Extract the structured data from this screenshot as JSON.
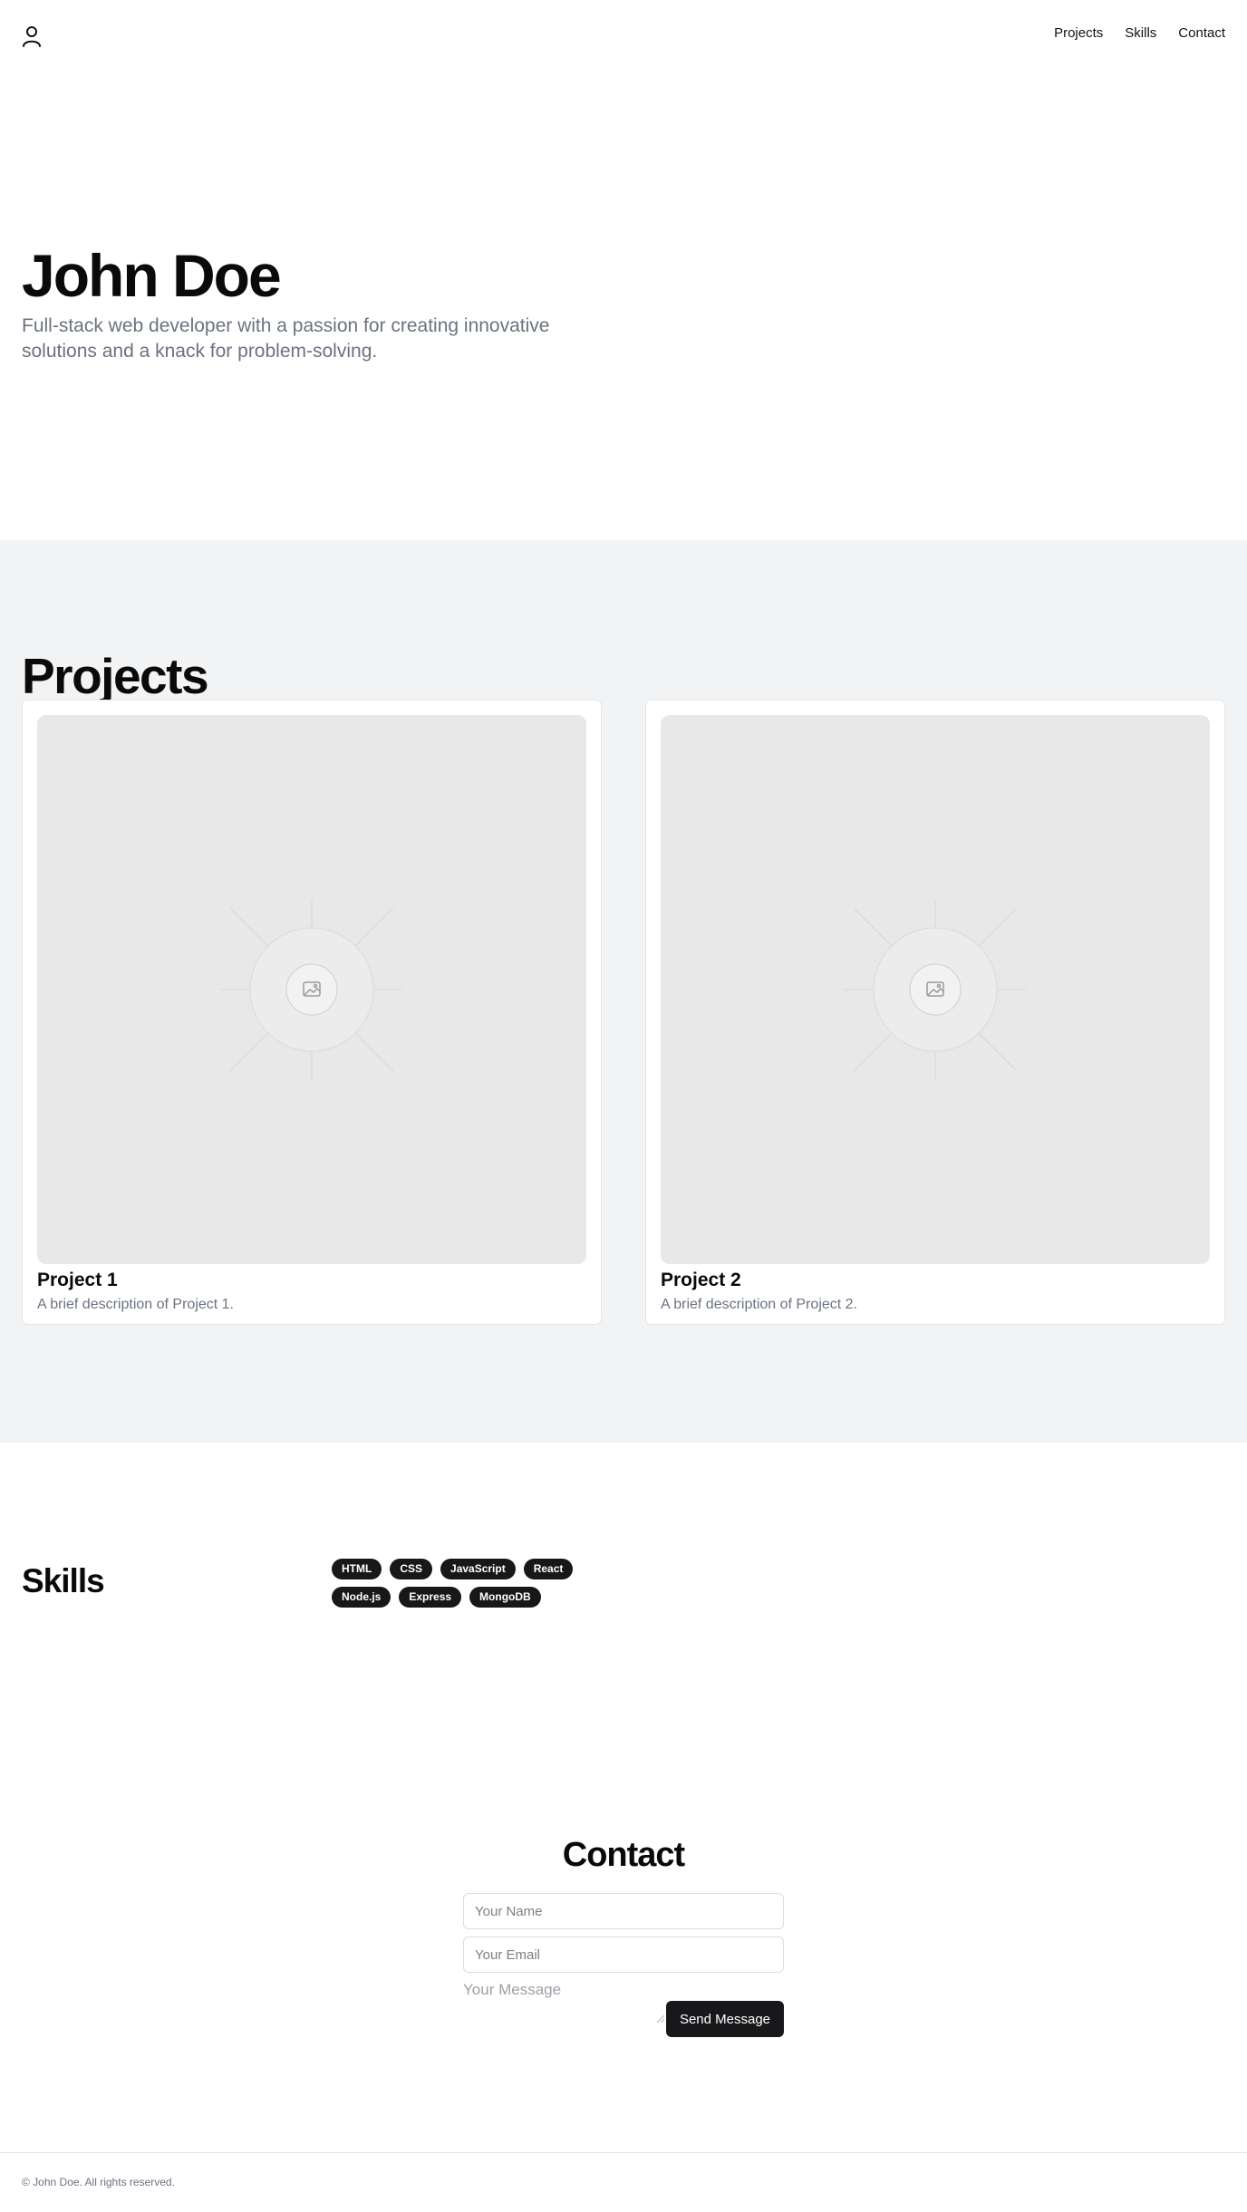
{
  "header": {
    "nav": [
      "Projects",
      "Skills",
      "Contact"
    ]
  },
  "hero": {
    "name": "John Doe",
    "tagline": "Full-stack web developer with a passion for creating innovative solutions and a knack for problem-solving."
  },
  "projects": {
    "title": "Projects",
    "items": [
      {
        "title": "Project 1",
        "description": "A brief description of Project 1."
      },
      {
        "title": "Project 2",
        "description": "A brief description of Project 2."
      }
    ]
  },
  "skills": {
    "title": "Skills",
    "items": [
      "HTML",
      "CSS",
      "JavaScript",
      "React",
      "Node.js",
      "Express",
      "MongoDB"
    ]
  },
  "contact": {
    "title": "Contact",
    "name_placeholder": "Your Name",
    "email_placeholder": "Your Email",
    "message_placeholder": "Your Message",
    "send_label": "Send Message"
  },
  "footer": {
    "text": "© John Doe. All rights reserved."
  },
  "colors": {
    "section_bg": "#f2f3f5",
    "muted_text": "#6b7280",
    "badge_bg": "#18181b",
    "button_bg": "#18181b"
  }
}
